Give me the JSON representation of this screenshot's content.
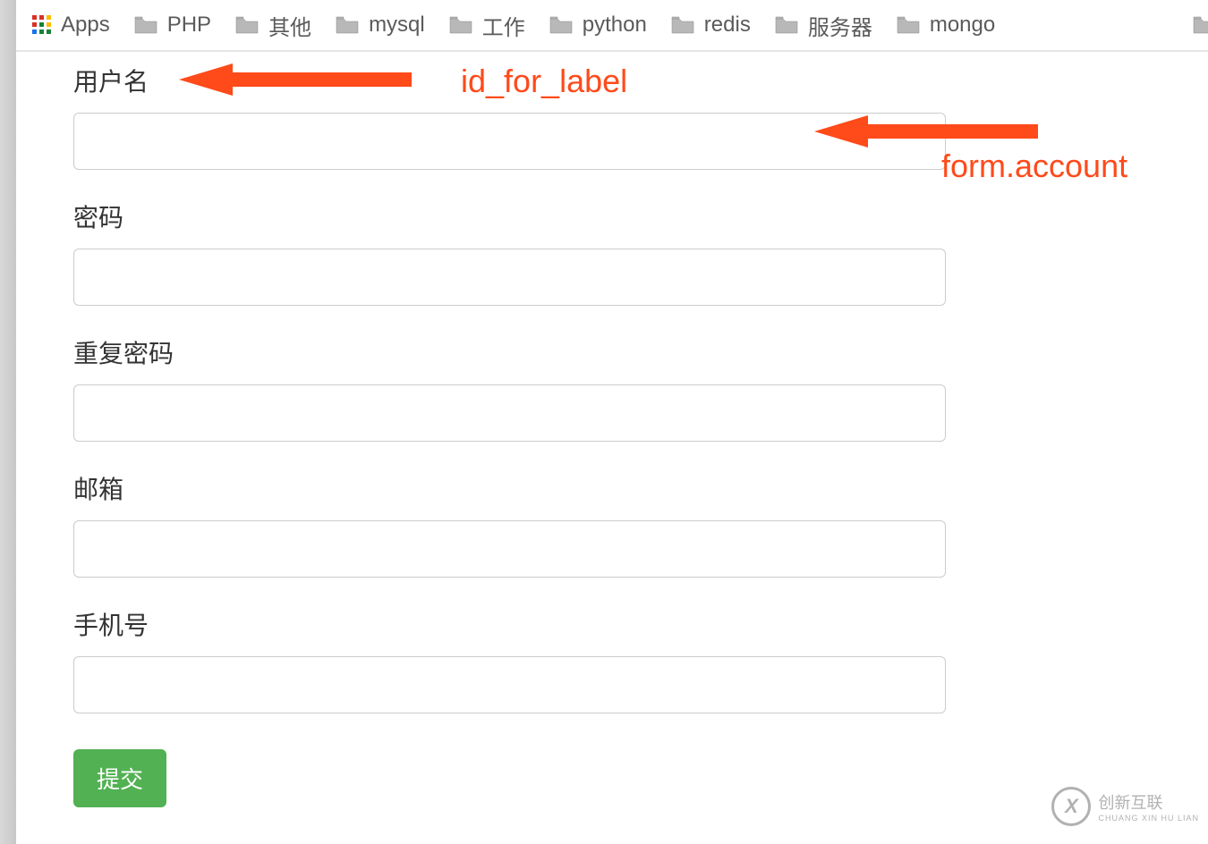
{
  "bookmarks": {
    "apps_label": "Apps",
    "items": [
      {
        "label": "PHP"
      },
      {
        "label": "其他"
      },
      {
        "label": "mysql"
      },
      {
        "label": "工作"
      },
      {
        "label": "python"
      },
      {
        "label": "redis"
      },
      {
        "label": "服务器"
      },
      {
        "label": "mongo"
      }
    ]
  },
  "form": {
    "fields": [
      {
        "label": "用户名",
        "value": ""
      },
      {
        "label": "密码",
        "value": ""
      },
      {
        "label": "重复密码",
        "value": ""
      },
      {
        "label": "邮箱",
        "value": ""
      },
      {
        "label": "手机号",
        "value": ""
      }
    ],
    "submit_label": "提交"
  },
  "annotations": {
    "label1": "id_for_label",
    "label2": "form.account"
  },
  "watermark": {
    "logo_text": "X",
    "main": "创新互联",
    "sub": "CHUANG XIN HU LIAN"
  },
  "colors": {
    "accent_orange": "#ff4a1a",
    "submit_green": "#52b152",
    "text_gray": "#5a5a5a"
  }
}
